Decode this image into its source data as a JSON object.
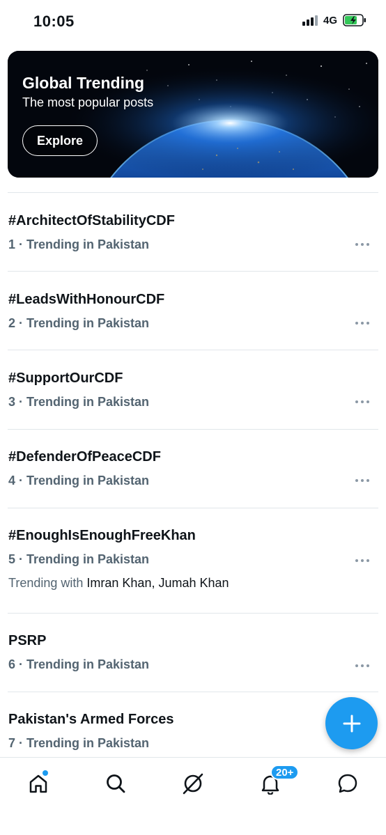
{
  "status_bar": {
    "time": "10:05",
    "network": "4G"
  },
  "banner": {
    "title": "Global Trending",
    "subtitle": "The most popular posts",
    "button_label": "Explore"
  },
  "trends": [
    {
      "name": "#ArchitectOfStabilityCDF",
      "meta": "1 · Trending in Pakistan"
    },
    {
      "name": "#LeadsWithHonourCDF",
      "meta": "2 · Trending in Pakistan"
    },
    {
      "name": "#SupportOurCDF",
      "meta": "3 · Trending in Pakistan"
    },
    {
      "name": "#DefenderOfPeaceCDF",
      "meta": "4 · Trending in Pakistan"
    },
    {
      "name": "#EnoughIsEnoughFreeKhan",
      "meta": "5 · Trending in Pakistan",
      "with_label": "Trending with",
      "with_people": "Imran Khan, Jumah Khan"
    },
    {
      "name": "PSRP",
      "meta": "6 · Trending in Pakistan"
    },
    {
      "name": "Pakistan's Armed Forces",
      "meta": "7 · Trending in Pakistan"
    }
  ],
  "bottom_nav": {
    "notifications_badge": "20+"
  },
  "colors": {
    "accent": "#1d9bf0",
    "secondary_text": "#536471"
  },
  "icons": [
    "home-icon",
    "search-icon",
    "grok-icon",
    "bell-icon",
    "message-icon",
    "plus-icon",
    "more-icon"
  ]
}
